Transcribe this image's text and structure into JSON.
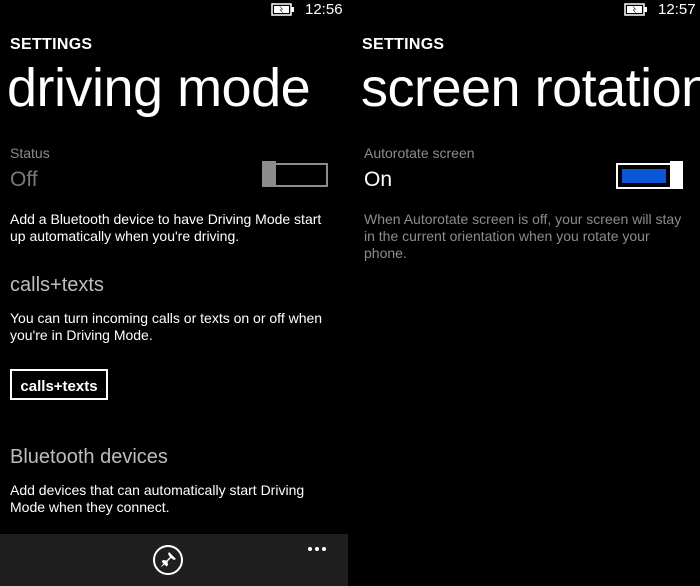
{
  "left": {
    "status_bar": {
      "time": "12:56",
      "battery_icon": "battery-charging-icon"
    },
    "header": {
      "app_label": "SETTINGS",
      "page_title": "driving mode"
    },
    "status": {
      "label": "Status",
      "value": "Off",
      "toggle_state": "off"
    },
    "description": "Add a Bluetooth device to have Driving Mode start up automatically when you're driving.",
    "calls_section": {
      "heading": "calls+texts",
      "description": "You can turn incoming calls or texts on or off when you're in Driving Mode.",
      "button_label": "calls+texts"
    },
    "bluetooth_section": {
      "heading": "Bluetooth devices",
      "description": "Add devices that can automatically start Driving Mode when they connect."
    },
    "app_bar": {
      "pin_icon": "pin-icon",
      "more_icon": "ellipsis-icon"
    }
  },
  "right": {
    "status_bar": {
      "time": "12:57",
      "battery_icon": "battery-charging-icon"
    },
    "header": {
      "app_label": "SETTINGS",
      "page_title": "screen rotation"
    },
    "autorotate": {
      "label": "Autorotate screen",
      "value": "On",
      "toggle_state": "on"
    },
    "description": "When Autorotate screen is off, your screen will stay in the current orientation when you rotate your phone."
  },
  "colors": {
    "background": "#000000",
    "accent": "#0a57d8",
    "muted": "#8c8c8c",
    "appbar": "#1f1f1f"
  }
}
